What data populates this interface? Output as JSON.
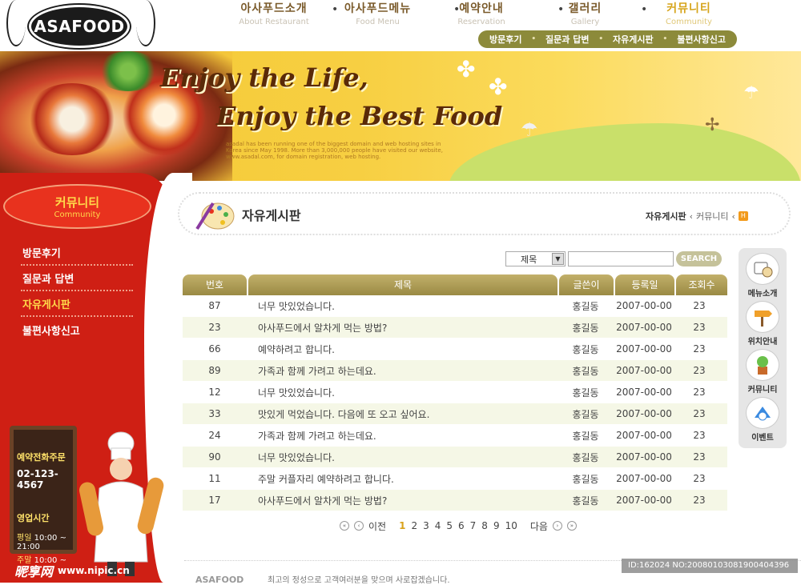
{
  "brand": {
    "logo": "ASAFOOD"
  },
  "topnav": [
    {
      "ko": "아사푸드소개",
      "en": "About Restaurant"
    },
    {
      "ko": "아사푸드메뉴",
      "en": "Food Menu"
    },
    {
      "ko": "예약안내",
      "en": "Reservation"
    },
    {
      "ko": "갤러리",
      "en": "Gallery"
    },
    {
      "ko": "커뮤니티",
      "en": "Community"
    }
  ],
  "subnav": [
    "방문후기",
    "질문과 답변",
    "자유게시판",
    "불편사항신고"
  ],
  "banner": {
    "line1": "Enjoy the Life,",
    "line2": "Enjoy the Best Food",
    "small": "asadal has been running one of the biggest domain and web hosting sites in Korea since May 1998. More than 3,000,000 people have visited our website, www.asadal.com, for domain registration, web hosting."
  },
  "sidebar": {
    "title_ko": "커뮤니티",
    "title_en": "Community",
    "items": [
      "방문후기",
      "질문과 답변",
      "자유게시판",
      "불편사항신고"
    ],
    "active": "자유게시판"
  },
  "board": {
    "order_label": "예약전화주문",
    "phone": "02-123-4567",
    "hours_label": "영업시간",
    "weekday_label": "평일",
    "weekday_hours": "10:00 ~ 21:00",
    "weekend_label": "주말",
    "weekend_hours": "10:00 ~ 23:00"
  },
  "content": {
    "title": "자유게시판",
    "breadcrumb": [
      "자유게시판",
      "커뮤니티"
    ],
    "home_icon": "H"
  },
  "search": {
    "select_value": "제목",
    "select_arrow": "▼",
    "button": "SEARCH"
  },
  "table": {
    "headers": [
      "번호",
      "제목",
      "글쓴이",
      "등록일",
      "조회수"
    ],
    "rows": [
      {
        "no": "87",
        "title": "너무 맛있었습니다.",
        "author": "홍길동",
        "date": "2007-00-00",
        "views": "23"
      },
      {
        "no": "23",
        "title": "아사푸드에서 알차게 먹는 방법?",
        "author": "홍길동",
        "date": "2007-00-00",
        "views": "23"
      },
      {
        "no": "66",
        "title": "예약하려고 합니다.",
        "author": "홍길동",
        "date": "2007-00-00",
        "views": "23"
      },
      {
        "no": "89",
        "title": "가족과 함께 가려고 하는데요.",
        "author": "홍길동",
        "date": "2007-00-00",
        "views": "23"
      },
      {
        "no": "12",
        "title": "너무 맛있었습니다.",
        "author": "홍길동",
        "date": "2007-00-00",
        "views": "23"
      },
      {
        "no": "33",
        "title": "맛있게 먹었습니다. 다음에 또 오고 싶어요.",
        "author": "홍길동",
        "date": "2007-00-00",
        "views": "23"
      },
      {
        "no": "24",
        "title": "가족과 함께 가려고 하는데요.",
        "author": "홍길동",
        "date": "2007-00-00",
        "views": "23"
      },
      {
        "no": "90",
        "title": "너무 맛있었습니다.",
        "author": "홍길동",
        "date": "2007-00-00",
        "views": "23"
      },
      {
        "no": "11",
        "title": "주말 커플자리 예약하려고 합니다.",
        "author": "홍길동",
        "date": "2007-00-00",
        "views": "23"
      },
      {
        "no": "17",
        "title": "아사푸드에서 알차게 먹는 방법?",
        "author": "홍길동",
        "date": "2007-00-00",
        "views": "23"
      }
    ]
  },
  "pager": {
    "prev": "이전",
    "next": "다음",
    "pages": [
      "1",
      "2",
      "3",
      "4",
      "5",
      "6",
      "7",
      "8",
      "9",
      "10"
    ],
    "current": "1",
    "first_icon": "«",
    "prev_icon": "‹",
    "next_icon": "›",
    "last_icon": "»"
  },
  "quickbar": [
    {
      "label": "메뉴소개",
      "icon": "menu-icon"
    },
    {
      "label": "위치안내",
      "icon": "location-icon"
    },
    {
      "label": "커뮤니티",
      "icon": "community-icon"
    },
    {
      "label": "이벤트",
      "icon": "event-icon"
    }
  ],
  "footer": {
    "logo": "ASAFOOD",
    "text": "최고의 정성으로 고객여러분을 맞으며 사로잡겠습니다."
  },
  "watermark": {
    "site": "昵享网",
    "url": "www.nipic.cn",
    "id": "ID:162024 NO:20080103081900404396"
  }
}
